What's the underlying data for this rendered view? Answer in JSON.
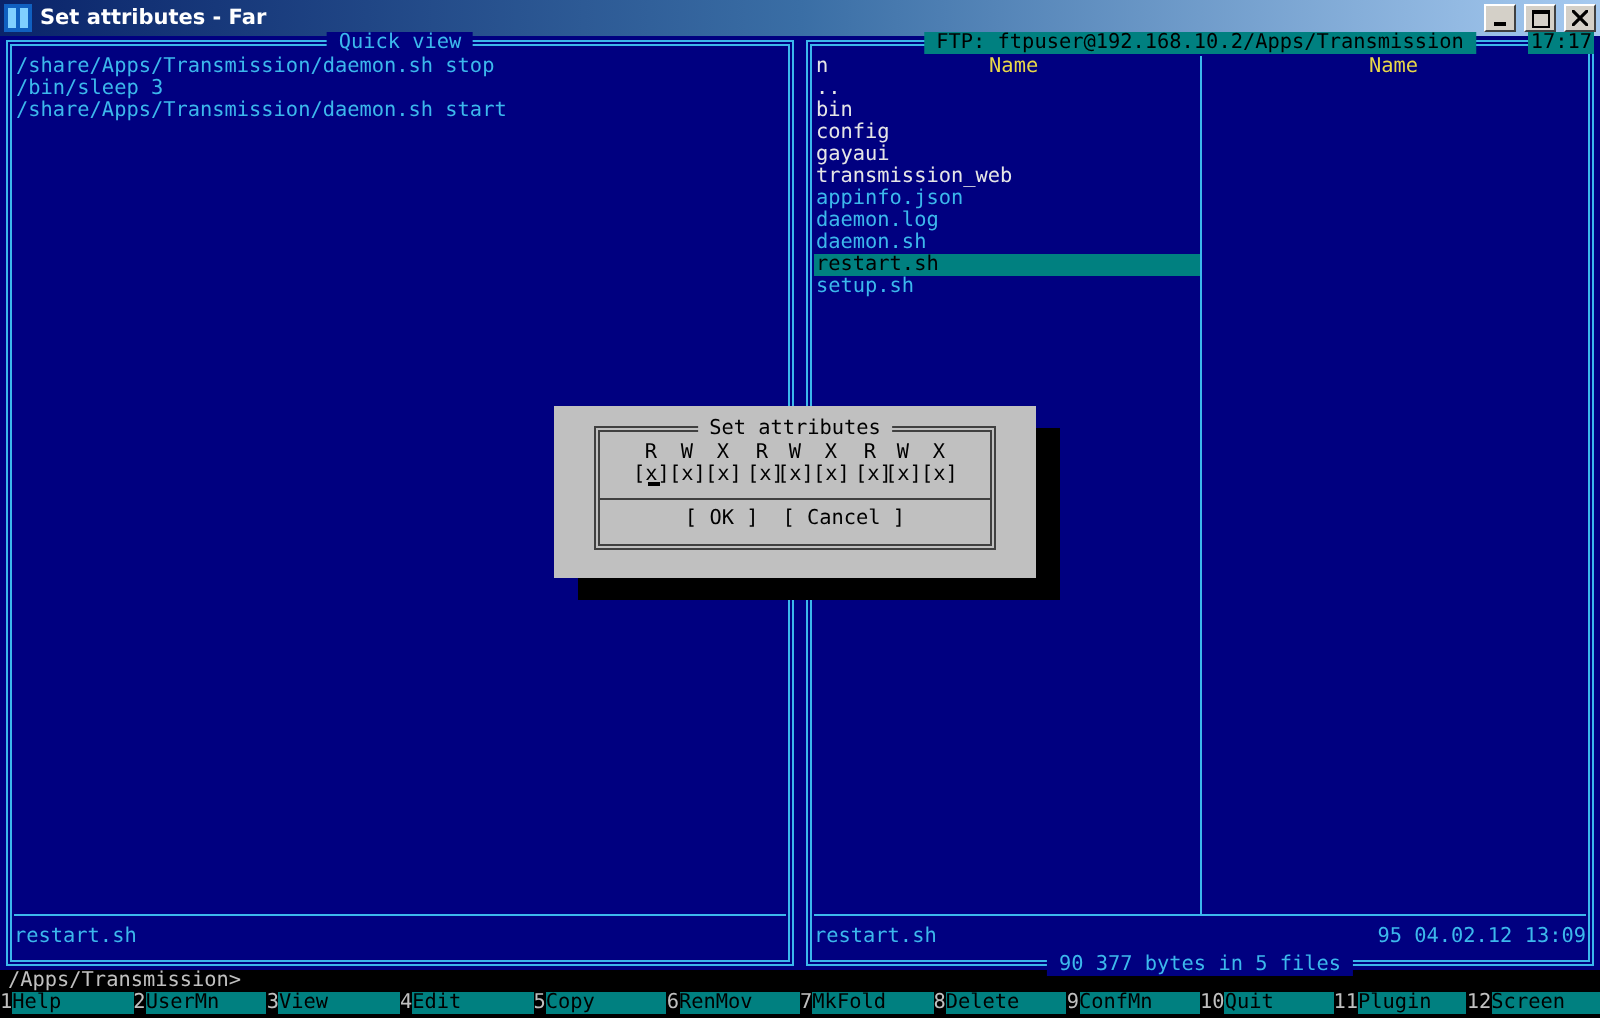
{
  "window": {
    "title": "Set attributes - Far"
  },
  "quick_view": {
    "title": "Quick view",
    "lines": [
      "/share/Apps/Transmission/daemon.sh stop",
      "/bin/sleep 3",
      "/share/Apps/Transmission/daemon.sh start"
    ],
    "footer": "restart.sh"
  },
  "right_panel": {
    "path": "FTP: ftpuser@192.168.10.2/Apps/Transmission",
    "clock": "17:17",
    "columns": [
      "n",
      "Name",
      "Name"
    ],
    "files": [
      {
        "name": "..",
        "kind": "dir",
        "selected": false
      },
      {
        "name": "bin",
        "kind": "dir",
        "selected": false
      },
      {
        "name": "config",
        "kind": "dir",
        "selected": false
      },
      {
        "name": "gayaui",
        "kind": "dir",
        "selected": false
      },
      {
        "name": "transmission_web",
        "kind": "dir",
        "selected": false
      },
      {
        "name": "appinfo.json",
        "kind": "file",
        "selected": false
      },
      {
        "name": "daemon.log",
        "kind": "file",
        "selected": false
      },
      {
        "name": "daemon.sh",
        "kind": "file",
        "selected": false
      },
      {
        "name": "restart.sh",
        "kind": "file",
        "selected": true
      },
      {
        "name": "setup.sh",
        "kind": "file",
        "selected": false
      }
    ],
    "footer_name": "restart.sh",
    "footer_info": "95 04.02.12 13:09",
    "summary": "90 377 bytes in 5 files"
  },
  "dialog": {
    "title": "Set attributes",
    "headers": [
      "R",
      "W",
      "X",
      "R",
      "W",
      "X",
      "R",
      "W",
      "X"
    ],
    "checkboxes": [
      {
        "open": "[",
        "mark": "x",
        "close": "]",
        "checked": true,
        "focused": true
      },
      {
        "open": "[",
        "mark": "x",
        "close": "]",
        "checked": true,
        "focused": false
      },
      {
        "open": "[",
        "mark": "x",
        "close": "]",
        "checked": true,
        "focused": false
      },
      {
        "open": "[",
        "mark": "x",
        "close": "]",
        "checked": true,
        "focused": false
      },
      {
        "open": "[",
        "mark": "x",
        "close": "]",
        "checked": true,
        "focused": false
      },
      {
        "open": "[",
        "mark": "x",
        "close": "]",
        "checked": true,
        "focused": false
      },
      {
        "open": "[",
        "mark": "x",
        "close": "]",
        "checked": true,
        "focused": false
      },
      {
        "open": "[",
        "mark": "x",
        "close": "]",
        "checked": true,
        "focused": false
      },
      {
        "open": "[",
        "mark": "x",
        "close": "]",
        "checked": true,
        "focused": false
      }
    ],
    "buttons": [
      "[ OK ]",
      "[ Cancel ]"
    ]
  },
  "command_line": "/Apps/Transmission>",
  "keybar": [
    {
      "num": "1",
      "label": "Help"
    },
    {
      "num": "2",
      "label": "UserMn"
    },
    {
      "num": "3",
      "label": "View"
    },
    {
      "num": "4",
      "label": "Edit"
    },
    {
      "num": "5",
      "label": "Copy"
    },
    {
      "num": "6",
      "label": "RenMov"
    },
    {
      "num": "7",
      "label": "MkFold"
    },
    {
      "num": "8",
      "label": "Delete"
    },
    {
      "num": "9",
      "label": "ConfMn"
    },
    {
      "num": "10",
      "label": "Quit"
    },
    {
      "num": "11",
      "label": "Plugin"
    },
    {
      "num": "12",
      "label": "Screen"
    }
  ]
}
